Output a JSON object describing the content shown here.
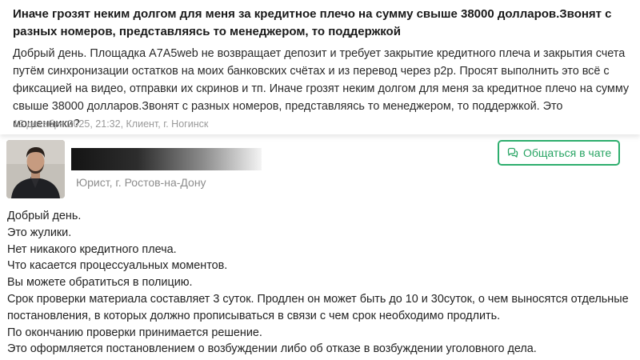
{
  "question": {
    "title": "Иначе грозят неким долгом для меня за кредитное плечо на сумму свыше 38000 долларов.Звонят с разных номеров, представляясь то менеджером, то поддержкой",
    "body": "Добрый день. Площадка A7A5web не возвращает депозит и требует закрытие кредитного плеча и закрытия счета путём синхронизации остатков на моих банковских счётах и из перевод через p2p. Просят выполнить это всё с фиксацией на видео, отправки их скринов и тп. Иначе грозят неким долгом для меня за кредитное плечо на сумму свыше 38000 долларов.Звонят с разных номеров, представляясь то менеджером, то поддержкой. Это мошенники?",
    "meta": "13 декабря 2025, 21:32, Клиент, г. Ногинск"
  },
  "answer": {
    "author_role": "Юрист, г. Ростов-на-Дону",
    "chat_button_label": "Общаться в чате",
    "lines": [
      "Добрый день.",
      "Это жулики.",
      "Нет никакого кредитного плеча.",
      "Что касается процессуальных моментов.",
      "Вы можете обратиться в полицию.",
      "Срок проверки материала составляет 3 суток. Продлен он может быть до 10 и 30суток, о чем выносятся отдельные постановления, в которых должно прописываться в связи с чем срок необходимо продлить.",
      "По окончанию проверки принимается решение.",
      "Это оформляется постановлением о возбуждении либо об отказе в возбуждении уголовного дела."
    ]
  },
  "colors": {
    "accent_green": "#2eae6e",
    "meta_gray": "#9a9a9a"
  },
  "icons": {
    "chat": "chat-bubbles-icon"
  }
}
